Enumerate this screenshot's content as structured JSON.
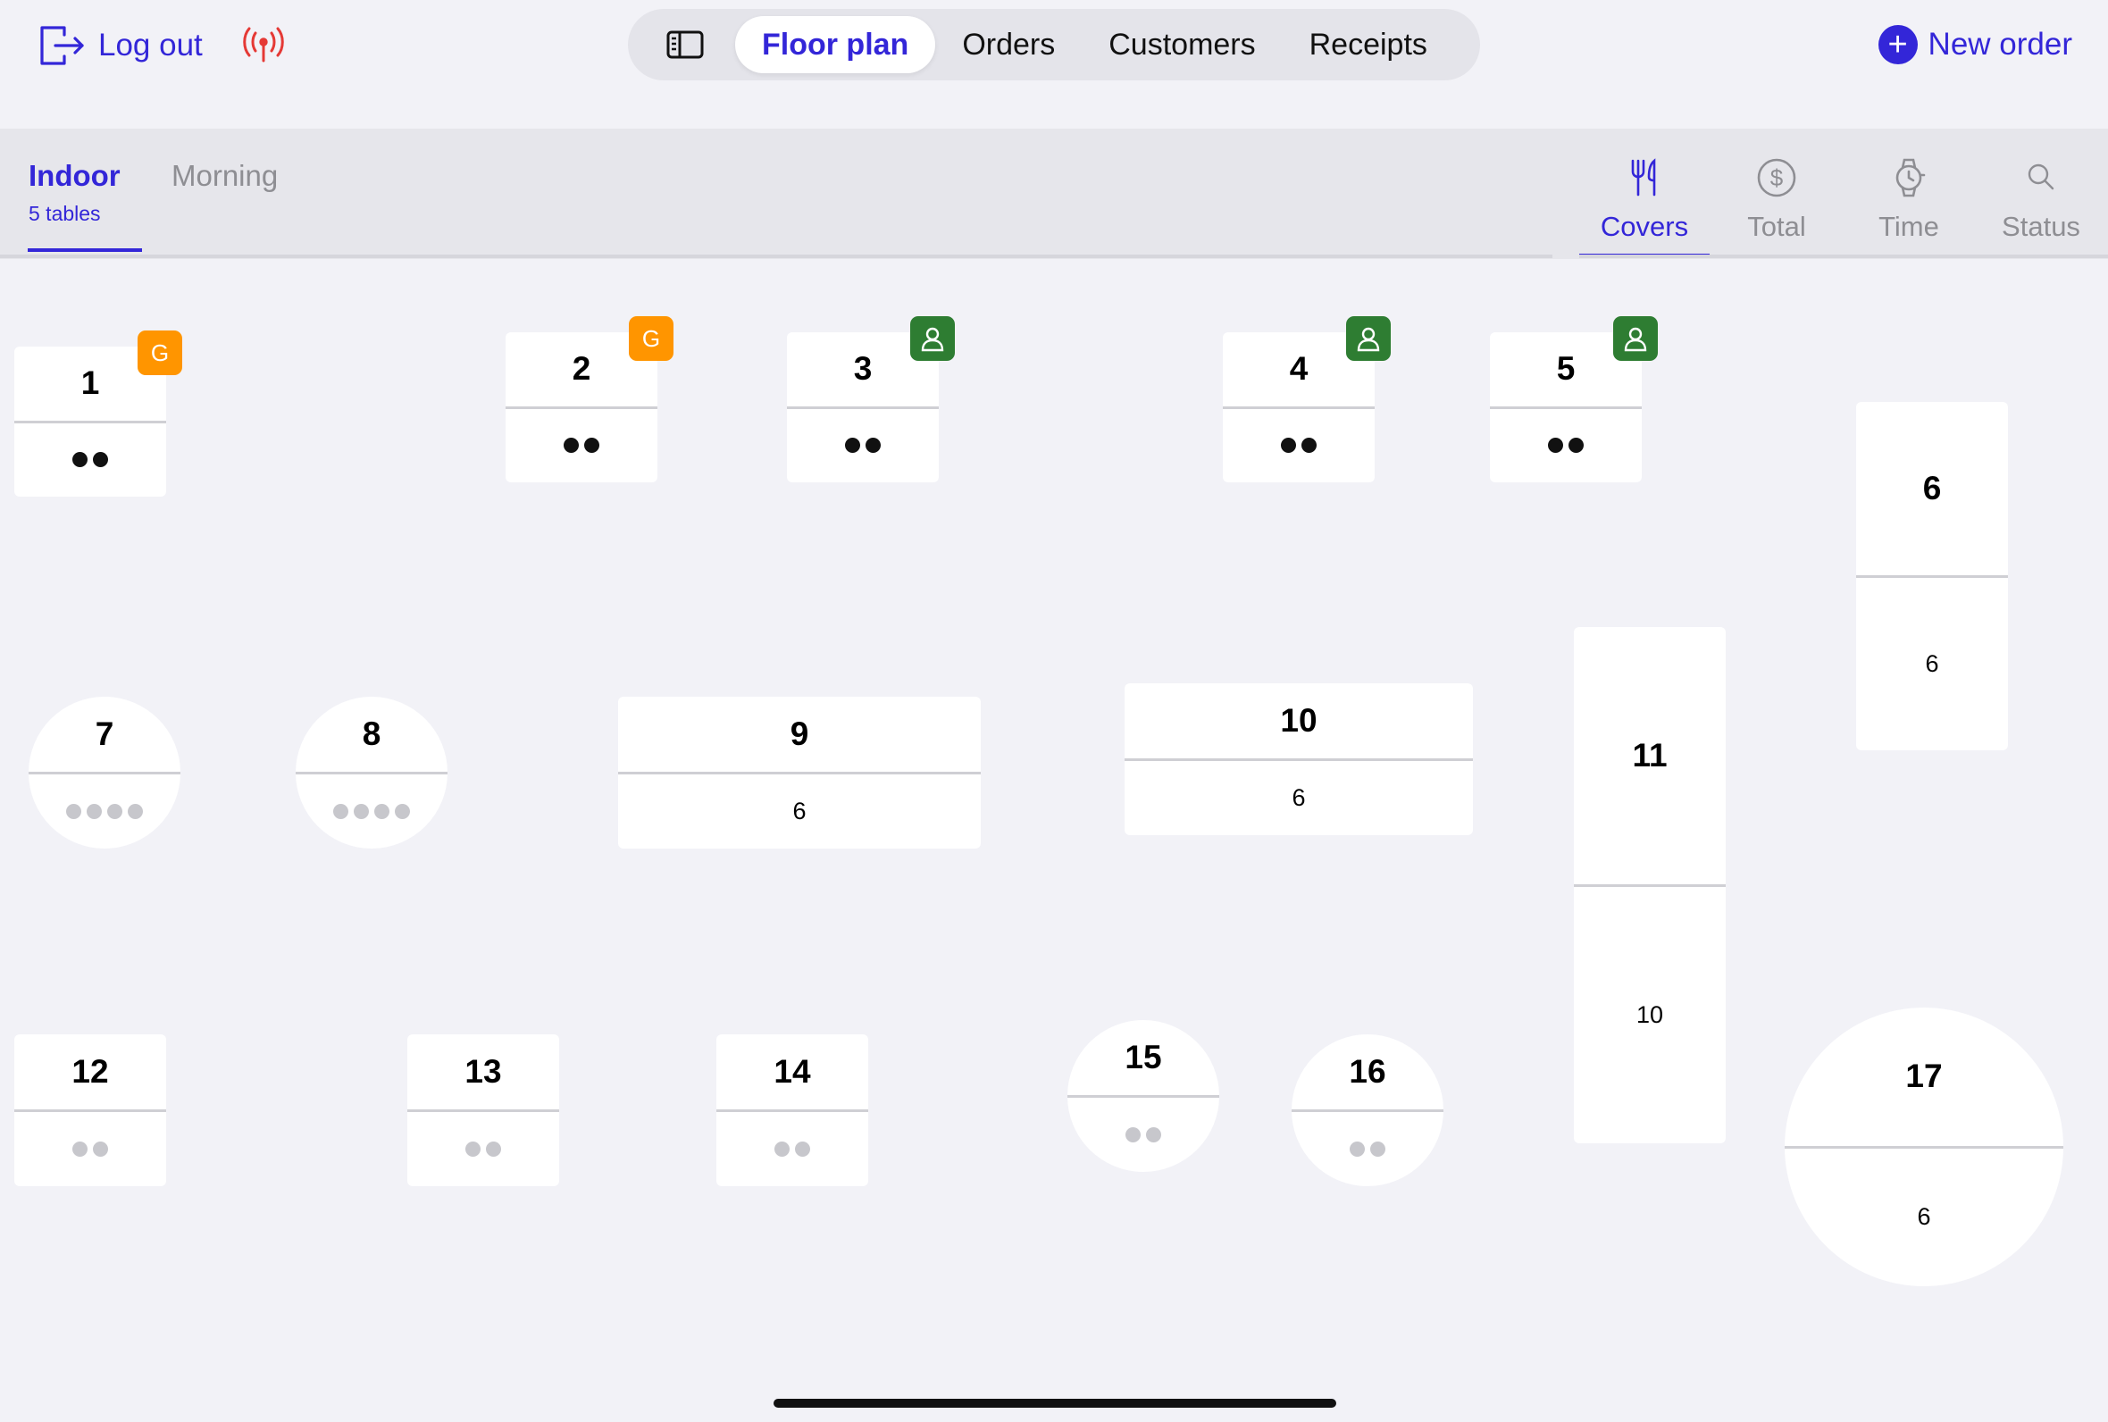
{
  "topbar": {
    "logout_label": "Log out",
    "tabs": [
      "Floor plan",
      "Orders",
      "Customers",
      "Receipts"
    ],
    "active_tab": "Floor plan",
    "new_order_label": "New order",
    "accent_color": "#3326d8",
    "signal_icon_color": "#e53935"
  },
  "areas": [
    {
      "name": "Indoor",
      "subtitle": "5 tables",
      "active": true
    },
    {
      "name": "Morning",
      "subtitle": "",
      "active": false
    }
  ],
  "modes": [
    {
      "label": "Covers",
      "icon": "fork-knife-icon",
      "active": true
    },
    {
      "label": "Total",
      "icon": "dollar-circle-icon",
      "active": false
    },
    {
      "label": "Time",
      "icon": "watch-icon",
      "active": false
    },
    {
      "label": "Status",
      "icon": "search-icon",
      "active": false
    }
  ],
  "tables": [
    {
      "number": "1",
      "covers": 2,
      "cover_text": "",
      "occupied": true,
      "badge": "G"
    },
    {
      "number": "2",
      "covers": 2,
      "cover_text": "",
      "occupied": true,
      "badge": "G"
    },
    {
      "number": "3",
      "covers": 2,
      "cover_text": "",
      "occupied": true,
      "badge": "person"
    },
    {
      "number": "4",
      "covers": 2,
      "cover_text": "",
      "occupied": true,
      "badge": "person"
    },
    {
      "number": "5",
      "covers": 2,
      "cover_text": "",
      "occupied": true,
      "badge": "person"
    },
    {
      "number": "6",
      "covers": 0,
      "cover_text": "6",
      "occupied": false,
      "badge": ""
    },
    {
      "number": "7",
      "covers": 4,
      "cover_text": "",
      "occupied": false,
      "badge": ""
    },
    {
      "number": "8",
      "covers": 4,
      "cover_text": "",
      "occupied": false,
      "badge": ""
    },
    {
      "number": "9",
      "covers": 0,
      "cover_text": "6",
      "occupied": false,
      "badge": ""
    },
    {
      "number": "10",
      "covers": 0,
      "cover_text": "6",
      "occupied": false,
      "badge": ""
    },
    {
      "number": "11",
      "covers": 0,
      "cover_text": "10",
      "occupied": false,
      "badge": ""
    },
    {
      "number": "12",
      "covers": 2,
      "cover_text": "",
      "occupied": false,
      "badge": ""
    },
    {
      "number": "13",
      "covers": 2,
      "cover_text": "",
      "occupied": false,
      "badge": ""
    },
    {
      "number": "14",
      "covers": 2,
      "cover_text": "",
      "occupied": false,
      "badge": ""
    },
    {
      "number": "15",
      "covers": 2,
      "cover_text": "",
      "occupied": false,
      "badge": ""
    },
    {
      "number": "16",
      "covers": 2,
      "cover_text": "",
      "occupied": false,
      "badge": ""
    },
    {
      "number": "17",
      "covers": 0,
      "cover_text": "6",
      "occupied": false,
      "badge": ""
    }
  ]
}
